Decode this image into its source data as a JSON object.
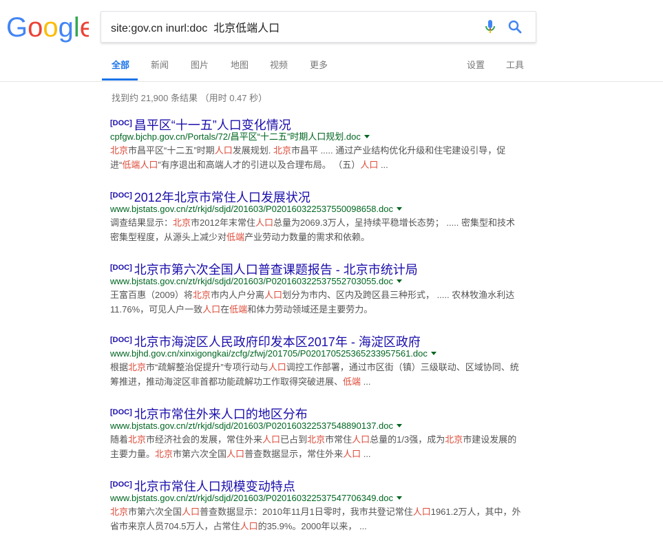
{
  "search": {
    "query": "site:gov.cn inurl:doc  北京低端人口"
  },
  "tabs": [
    {
      "label": "全部",
      "active": true
    },
    {
      "label": "新闻"
    },
    {
      "label": "图片"
    },
    {
      "label": "地图"
    },
    {
      "label": "视频"
    },
    {
      "label": "更多"
    },
    {
      "label": "设置"
    },
    {
      "label": "工具"
    }
  ],
  "stats": "找到约 21,900 条结果  （用时 0.47 秒）",
  "colors": {
    "link": "#1a0dab",
    "url": "#006621",
    "highlight": "#dd4b39",
    "accent": "#1a73e8"
  },
  "results": [
    {
      "tag": "[DOC]",
      "title": "昌平区“十一五”人口变化情况",
      "url": "cpfgw.bjchp.gov.cn/Portals/72/昌平区“十二五”时期人口规划.doc",
      "snippet": [
        [
          {
            "t": "北京",
            "h": true
          },
          {
            "t": "市昌平区“十二五”时期"
          },
          {
            "t": "人口",
            "h": true
          },
          {
            "t": "发展规划. "
          },
          {
            "t": "北京",
            "h": true
          },
          {
            "t": "市昌平 ..... 通过产业结构优化升级和住宅建设引导，促"
          }
        ],
        [
          {
            "t": "进“"
          },
          {
            "t": "低端人口",
            "h": true
          },
          {
            "t": "”有序退出和高端人才的引进以及合理布局。 （五）"
          },
          {
            "t": "人口",
            "h": true
          },
          {
            "t": " ..."
          }
        ]
      ]
    },
    {
      "tag": "[DOC]",
      "title": "2012年北京市常住人口发展状况",
      "url": "www.bjstats.gov.cn/zt/rkjd/sdjd/201603/P020160322537550098658.doc",
      "snippet": [
        [
          {
            "t": "调查结果显示："
          },
          {
            "t": "北京",
            "h": true
          },
          {
            "t": "市2012年末常住"
          },
          {
            "t": "人口",
            "h": true
          },
          {
            "t": "总量为2069.3万人，呈持续平稳增长态势； ..... 密集型和技术"
          }
        ],
        [
          {
            "t": "密集型程度，从源头上减少对"
          },
          {
            "t": "低端",
            "h": true
          },
          {
            "t": "产业劳动力数量的需求和依赖。"
          }
        ]
      ]
    },
    {
      "tag": "[DOC]",
      "title": "北京市第六次全国人口普查课题报告 - 北京市统计局",
      "url": "www.bjstats.gov.cn/zt/rkjd/sdjd/201603/P020160322537552703055.doc",
      "snippet": [
        [
          {
            "t": "王富百惠（2009）将"
          },
          {
            "t": "北京",
            "h": true
          },
          {
            "t": "市内人户分离"
          },
          {
            "t": "人口",
            "h": true
          },
          {
            "t": "划分为市内、区内及跨区县三种形式， ..... 农林牧渔水利达"
          }
        ],
        [
          {
            "t": "11.76%，可见人户一致"
          },
          {
            "t": "人口",
            "h": true
          },
          {
            "t": "在"
          },
          {
            "t": "低端",
            "h": true
          },
          {
            "t": "和体力劳动领域还是主要劳力。"
          }
        ]
      ]
    },
    {
      "tag": "[DOC]",
      "title": "北京市海淀区人民政府印发本区2017年 - 海淀区政府",
      "url": "www.bjhd.gov.cn/xinxigongkai/zcfg/zfwj/201705/P020170525365233957561.doc",
      "snippet": [
        [
          {
            "t": "根据"
          },
          {
            "t": "北京",
            "h": true
          },
          {
            "t": "市“疏解整治促提升”专项行动与"
          },
          {
            "t": "人口",
            "h": true
          },
          {
            "t": "调控工作部署，通过市区街（镇）三级联动、区域协同、统"
          }
        ],
        [
          {
            "t": "筹推进，推动海淀区非首都功能疏解功工作取得突破进展、"
          },
          {
            "t": "低端",
            "h": true
          },
          {
            "t": " ..."
          }
        ]
      ]
    },
    {
      "tag": "[DOC]",
      "title": "北京市常住外来人口的地区分布",
      "url": "www.bjstats.gov.cn/zt/rkjd/sdjd/201603/P020160322537548890137.doc",
      "snippet": [
        [
          {
            "t": "随着"
          },
          {
            "t": "北京",
            "h": true
          },
          {
            "t": "市经济社会的发展，常住外来"
          },
          {
            "t": "人口",
            "h": true
          },
          {
            "t": "已占到"
          },
          {
            "t": "北京",
            "h": true
          },
          {
            "t": "市常住"
          },
          {
            "t": "人口",
            "h": true
          },
          {
            "t": "总量的1/3强，成为"
          },
          {
            "t": "北京",
            "h": true
          },
          {
            "t": "市建设发展的"
          }
        ],
        [
          {
            "t": "主要力量。"
          },
          {
            "t": "北京",
            "h": true
          },
          {
            "t": "市第六次全国"
          },
          {
            "t": "人口",
            "h": true
          },
          {
            "t": "普查数据显示，常住外来"
          },
          {
            "t": "人口",
            "h": true
          },
          {
            "t": " ..."
          }
        ]
      ]
    },
    {
      "tag": "[DOC]",
      "title": "北京市常住人口规模变动特点",
      "url": "www.bjstats.gov.cn/zt/rkjd/sdjd/201603/P020160322537547706349.doc",
      "snippet": [
        [
          {
            "t": "北京",
            "h": true
          },
          {
            "t": "市第六次全国"
          },
          {
            "t": "人口",
            "h": true
          },
          {
            "t": "普查数据显示：2010年11月1日零时，我市共登记常住"
          },
          {
            "t": "人口",
            "h": true
          },
          {
            "t": "1961.2万人，其中，外"
          }
        ],
        [
          {
            "t": "省市来京人员704.5万人，占常住"
          },
          {
            "t": "人口",
            "h": true
          },
          {
            "t": "的35.9%。2000年以来， ..."
          }
        ]
      ]
    }
  ]
}
